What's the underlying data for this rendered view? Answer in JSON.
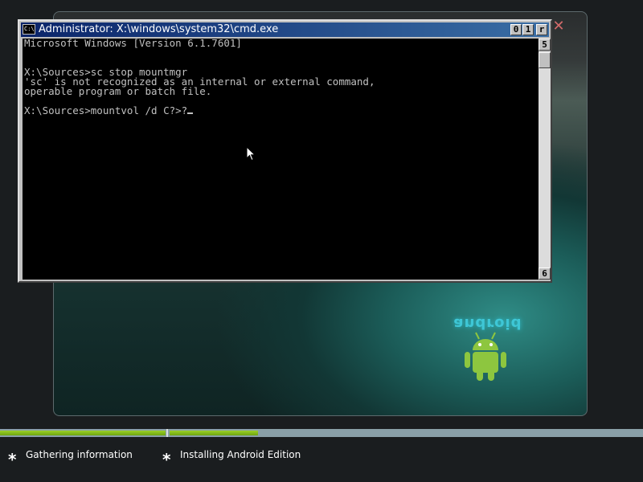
{
  "console": {
    "title": "Administrator: X:\\windows\\system32\\cmd.exe",
    "icon_text": "C:\\",
    "title_buttons": [
      "0",
      "1",
      "r"
    ],
    "lines": [
      "Microsoft Windows [Version 6.1.7601]",
      "",
      "",
      "X:\\Sources>sc stop mountmgr",
      "'sc' is not recognized as an internal or external command,",
      "operable program or batch file.",
      "",
      "X:\\Sources>mountvol /d C?>?"
    ],
    "scroll_up_glyph": "5",
    "scroll_down_glyph": "6"
  },
  "setup": {
    "close_glyph": "✕",
    "logo_text": "android",
    "colors": {
      "accent": "#3ec7d6",
      "robot": "#8dc63f",
      "progress": "#7cb518"
    }
  },
  "steps": [
    {
      "label": "Gathering information"
    },
    {
      "label": "Installing Android Edition"
    }
  ]
}
